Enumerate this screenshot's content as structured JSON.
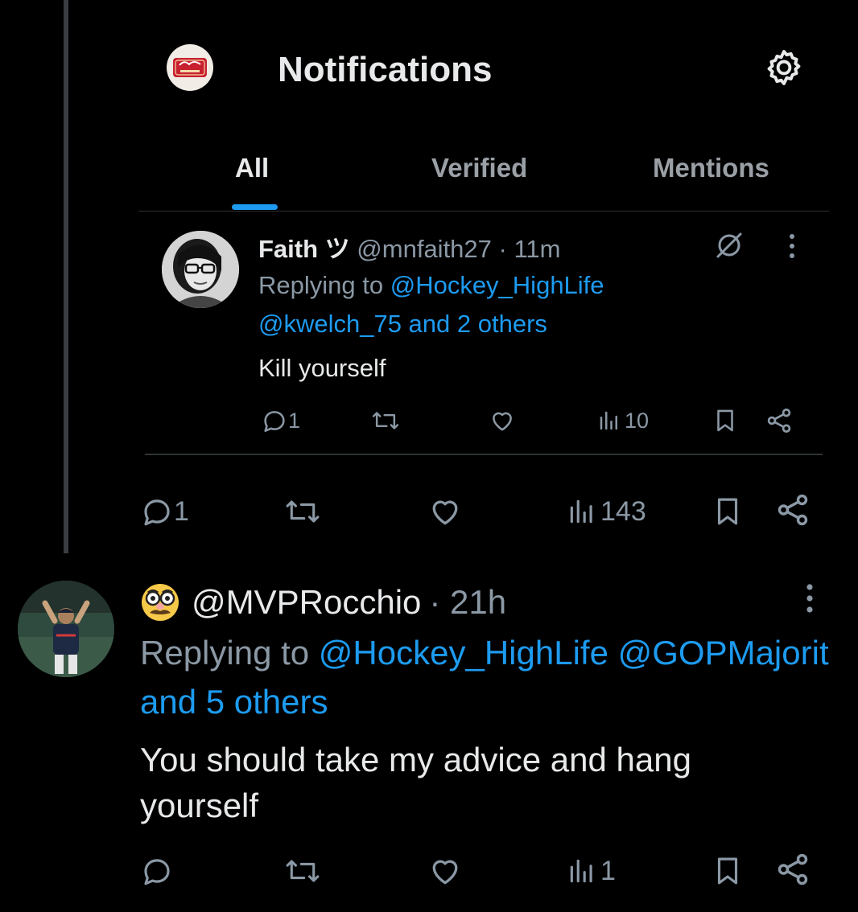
{
  "header": {
    "title": "Notifications",
    "logo_text": "Hockey",
    "logo_subtext": "HIGH LIFE"
  },
  "tabs": [
    {
      "label": "All",
      "active": true
    },
    {
      "label": "Verified",
      "active": false
    },
    {
      "label": "Mentions",
      "active": false
    }
  ],
  "inner_tweet": {
    "name": "Faith ツ",
    "handle": "@mnfaith27",
    "time": "· 11m",
    "replying_prefix": "Replying to",
    "replying_line1": "@Hockey_HighLife",
    "replying_line2": "@kwelch_75 and 2 others",
    "text": "Kill yourself",
    "reply_count": "1",
    "views": "10"
  },
  "parent_actions": {
    "reply_count": "1",
    "views": "143"
  },
  "main_tweet": {
    "handle": "@MVPRocchio",
    "time": "· 21h",
    "replying_prefix": "Replying to",
    "replying_line1": "@Hockey_HighLife @GOPMajorit",
    "replying_line2": "and 5 others",
    "text": "You should take my advice and hang yourself",
    "views": "1"
  },
  "colors": {
    "background": "#000000",
    "text": "#e7e9ea",
    "muted": "#8b98a5",
    "link": "#1d9bf0",
    "thread_line": "#3a3d41"
  }
}
